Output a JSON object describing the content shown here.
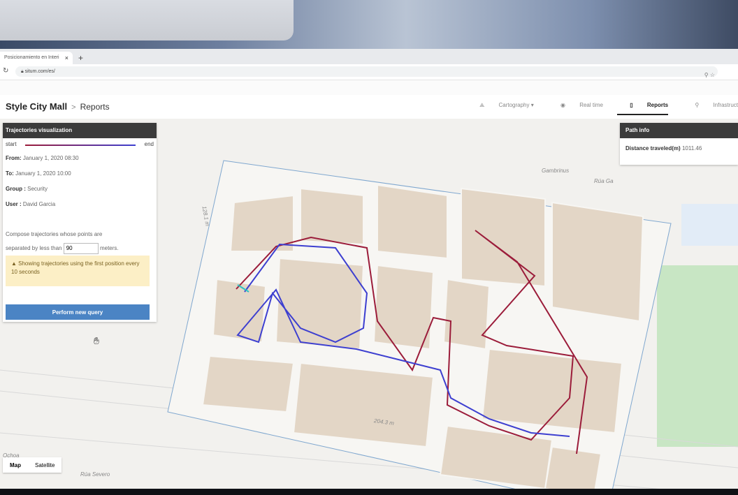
{
  "browser": {
    "tab_title": "Posicionamiento en Interi",
    "tab_close": "×",
    "new_tab": "+",
    "url": "situm.com/es/"
  },
  "app": {
    "venue": "Style City Mall",
    "separator": ">",
    "section": "Reports",
    "nav": [
      {
        "label": "Cartography",
        "icon": "layers-icon"
      },
      {
        "label": "Real time",
        "icon": "realtime-icon"
      },
      {
        "label": "Reports",
        "icon": "reports-icon",
        "active": true
      },
      {
        "label": "Infrastruct",
        "icon": "infrastructure-icon"
      }
    ]
  },
  "trajectories": {
    "title": "Trajectories visualization",
    "legend_start": "start",
    "legend_end": "end",
    "from_label": "From:",
    "from_value": "January 1, 2020 08:30",
    "to_label": "To:",
    "to_value": "January 1, 2020 10:00",
    "group_label": "Group :",
    "group_value": "Security",
    "user_label": "User :",
    "user_value": "David Garcia",
    "compose_text_1": "Compose trajectories whose points are",
    "compose_text_2": "separated by less than",
    "compose_value": "90",
    "compose_unit": "meters.",
    "alert_text": "Showing trajectories using the first position every 10 seconds",
    "button_label": "Perform new query"
  },
  "path_info": {
    "title": "Path info",
    "distance_label": "Distance traveled(m)",
    "distance_value": "1011.46"
  },
  "map": {
    "toggle_map": "Map",
    "toggle_satellite": "Satellite",
    "street_labels": [
      "Gambrinus",
      "Rúa Ga",
      "Rúa Severo",
      "Ochoa"
    ],
    "dimension_labels": [
      "128.1 m",
      "204.3 m"
    ]
  },
  "colors": {
    "start_color": "#9b1c3a",
    "end_color": "#3d3fd0",
    "button": "#4b84c4",
    "alert_bg": "#fcefc6"
  }
}
